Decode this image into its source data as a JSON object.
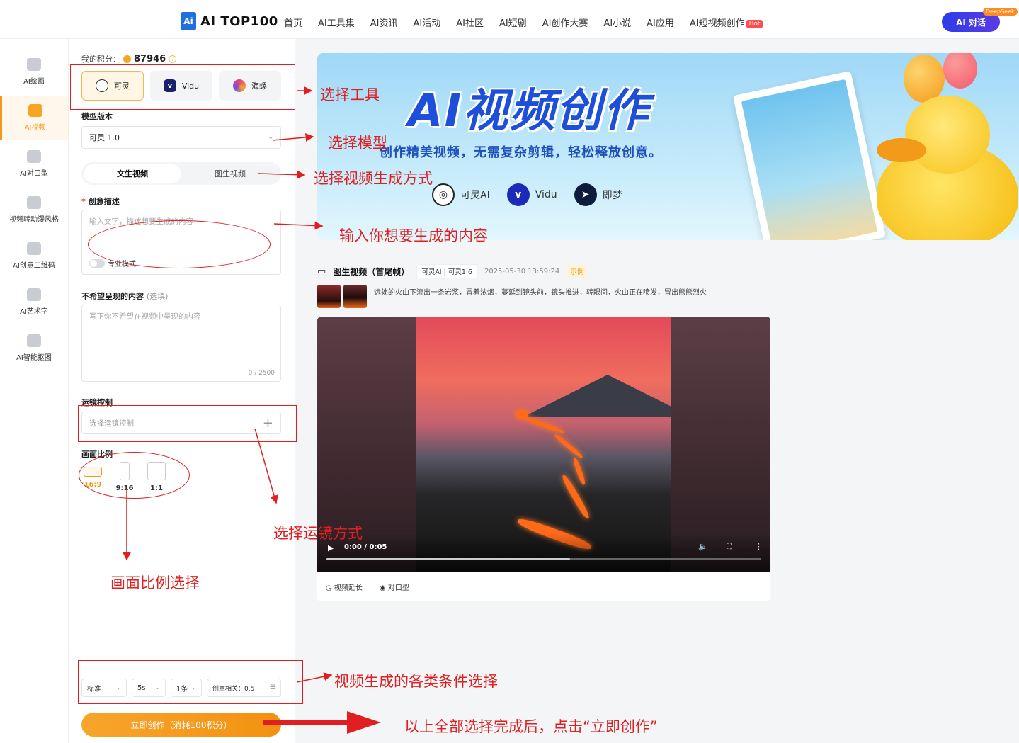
{
  "header": {
    "logo_text": "AI TOP100",
    "logo_mark": "Ai",
    "nav": [
      "首页",
      "AI工具集",
      "AI资讯",
      "AI活动",
      "AI社区",
      "AI短剧",
      "AI创作大赛",
      "AI小说",
      "AI应用",
      "AI短视频创作"
    ],
    "hot_badge": "Hot",
    "chat_button": "AI 对话",
    "deepseek_badge": "DeepSeek"
  },
  "sidebar": {
    "items": [
      {
        "label": "AI绘画",
        "icon": "image-icon"
      },
      {
        "label": "AI视频",
        "icon": "video-icon",
        "active": true
      },
      {
        "label": "AI对口型",
        "icon": "lips-icon"
      },
      {
        "label": "视频转动漫风格",
        "icon": "anime-icon"
      },
      {
        "label": "AI创意二维码",
        "icon": "qrcode-icon"
      },
      {
        "label": "AI艺术字",
        "icon": "art-text-icon"
      },
      {
        "label": "AI智能抠图",
        "icon": "cutout-icon"
      }
    ]
  },
  "form": {
    "points_label": "我的积分：",
    "points_value": "87946",
    "help_mark": "?",
    "tools": [
      {
        "label": "可灵",
        "selected": true,
        "color": "#333333"
      },
      {
        "label": "Vidu",
        "selected": false,
        "color": "#1a1f6e"
      },
      {
        "label": "海螺",
        "selected": false,
        "color": "#e0437a"
      }
    ],
    "model_label": "模型版本",
    "model_value": "可灵 1.0",
    "mode_tabs": [
      "文生视频",
      "图生视频"
    ],
    "prompt_label": "创意描述",
    "required_mark": "*",
    "prompt_placeholder": "输入文字，描述想要生成的内容",
    "pro_mode_label": "专业模式",
    "negative_label": "不希望呈现的内容",
    "negative_optional": "(选填)",
    "negative_placeholder": "写下你不希望在视频中呈现的内容",
    "negative_counter": "0 / 2500",
    "camera_label": "运镜控制",
    "camera_placeholder": "选择运镜控制",
    "ratio_label": "画面比例",
    "ratios": [
      "16:9",
      "9:16",
      "1:1"
    ],
    "ratio_selected": "16:9",
    "options": [
      "标准",
      "5s",
      "1条"
    ],
    "creativity_label": "创意相关：0.5",
    "create_button": "立即创作（消耗100积分）"
  },
  "banner": {
    "title": "AI视频创作",
    "subtitle": "创作精美视频，无需复杂剪辑，轻松释放创意。",
    "brands": [
      {
        "label": "可灵AI",
        "color": "#222222",
        "icon": "kling-icon"
      },
      {
        "label": "Vidu",
        "color": "#1b2bb8",
        "icon": "vidu-icon"
      },
      {
        "label": "即梦",
        "color": "#0d1b3d",
        "icon": "jimeng-icon"
      }
    ]
  },
  "result": {
    "title": "图生视频（首尾帧）",
    "model_tag": "可灵AI | 可灵1.6",
    "time": "2025-05-30 13:59:24",
    "demo_tag": "示例",
    "prompt": "远处的火山下流出一条岩浆，冒着浓烟，蔓延到镜头前，镜头推进，转眼间，火山正在喷发，冒出熊熊烈火",
    "video_time": "0:00 / 0:05",
    "video_progress": 0.56,
    "actions": [
      "视频延长",
      "对口型"
    ]
  },
  "annotations": {
    "select_tool": "选择工具",
    "select_model": "选择模型",
    "select_mode": "选择视频生成方式",
    "input_content": "输入你想要生成的内容",
    "select_camera": "选择运镜方式",
    "select_ratio": "画面比例选择",
    "select_conditions": "视频生成的各类条件选择",
    "click_create": "以上全部选择完成后，点击“立即创作”"
  },
  "colors": {
    "accent": "#f29a1b",
    "annotation": "#e02020",
    "brand_blue": "#1e4fd8"
  }
}
